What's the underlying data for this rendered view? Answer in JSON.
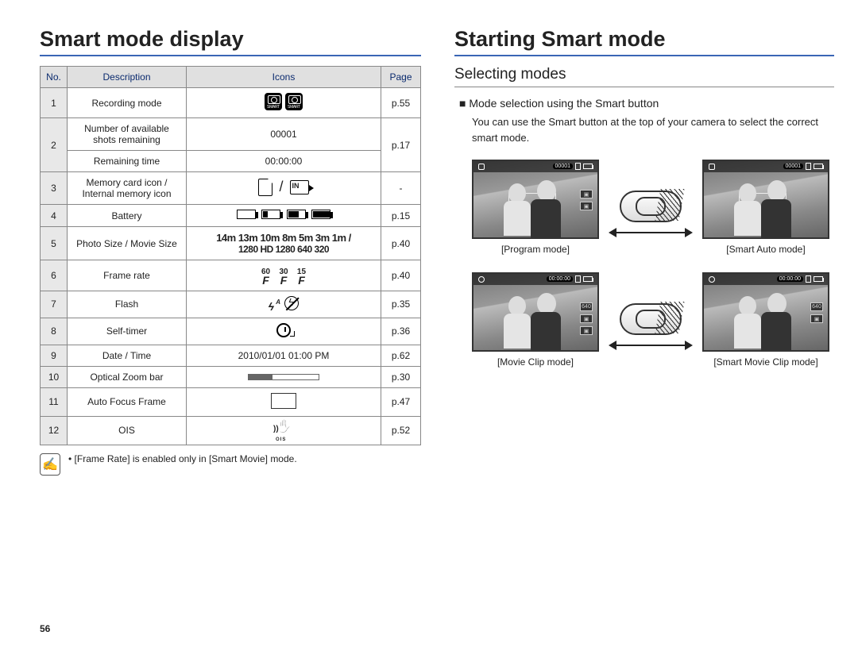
{
  "page_number": "56",
  "left": {
    "title": "Smart mode display",
    "table": {
      "headers": {
        "no": "No.",
        "desc": "Description",
        "icons": "Icons",
        "page": "Page"
      },
      "rows": [
        {
          "no": "1",
          "desc": "Recording mode",
          "icons": "camera-smart-badges",
          "page": "p.55"
        },
        {
          "no": "2a",
          "desc": "Number of available shots remaining",
          "icons_text": "00001",
          "page": "p.17"
        },
        {
          "no": "2b",
          "desc": "Remaining time",
          "icons_text": "00:00:00",
          "page": ""
        },
        {
          "no": "3",
          "desc": "Memory card icon / Internal memory icon",
          "icons": "memory",
          "page": "-"
        },
        {
          "no": "4",
          "desc": "Battery",
          "icons": "battery-levels",
          "page": "p.15"
        },
        {
          "no": "5",
          "desc": "Photo Size / Movie Size",
          "icons": "sizes",
          "page": "p.40"
        },
        {
          "no": "6",
          "desc": "Frame rate",
          "icons": "frame-rate",
          "page": "p.40"
        },
        {
          "no": "7",
          "desc": "Flash",
          "icons": "flash",
          "page": "p.35"
        },
        {
          "no": "8",
          "desc": "Self-timer",
          "icons": "self-timer",
          "page": "p.36"
        },
        {
          "no": "9",
          "desc": "Date / Time",
          "icons_text": "2010/01/01  01:00 PM",
          "page": "p.62"
        },
        {
          "no": "10",
          "desc": "Optical Zoom bar",
          "icons": "zoom-bar",
          "page": "p.30"
        },
        {
          "no": "11",
          "desc": "Auto Focus Frame",
          "icons": "af-frame",
          "page": "p.47"
        },
        {
          "no": "12",
          "desc": "OIS",
          "icons": "ois",
          "page": "p.52"
        }
      ]
    },
    "note_bullet": "•",
    "note_text": "[Frame Rate] is enabled only in [Smart Movie] mode.",
    "size_icons": {
      "photo": "14m 13m 10m 8m 5m 3m 1m /",
      "movie": "1280 HD 1280 640 320"
    },
    "frame_rates": [
      "60",
      "30",
      "15"
    ]
  },
  "right": {
    "title": "Starting Smart mode",
    "subtitle": "Selecting modes",
    "heading": "Mode selection using the Smart button",
    "body": "You can use the Smart button at the top of your camera to select the correct smart mode.",
    "thumb_top_text": "00001",
    "thumb_top_text_movie": "00:00:00",
    "thumb_side_text": "640",
    "modes": {
      "tl": "[Program mode]",
      "tr": "[Smart Auto mode]",
      "bl": "[Movie Clip mode]",
      "br": "[Smart Movie Clip mode]"
    }
  }
}
